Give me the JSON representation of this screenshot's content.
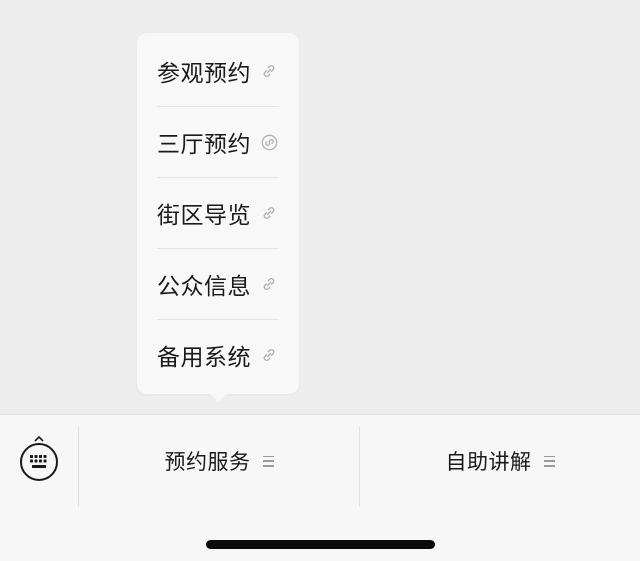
{
  "popup_menu": {
    "items": [
      {
        "label": "参观预约",
        "icon": "link-icon"
      },
      {
        "label": "三厅预约",
        "icon": "mini-program-icon"
      },
      {
        "label": "街区导览",
        "icon": "link-icon"
      },
      {
        "label": "公众信息",
        "icon": "link-icon"
      },
      {
        "label": "备用系统",
        "icon": "link-icon"
      }
    ]
  },
  "bottom_bar": {
    "keyboard_icon": "keyboard-switch-icon",
    "menus": [
      {
        "label": "预约服务",
        "icon": "menu-lines-icon"
      },
      {
        "label": "自助讲解",
        "icon": "menu-lines-icon"
      }
    ]
  },
  "colors": {
    "background": "#ededed",
    "popup": "#f8f8f8",
    "bar": "#f7f7f7",
    "text": "#1a1a1a",
    "icon": "#9a9a9a"
  }
}
